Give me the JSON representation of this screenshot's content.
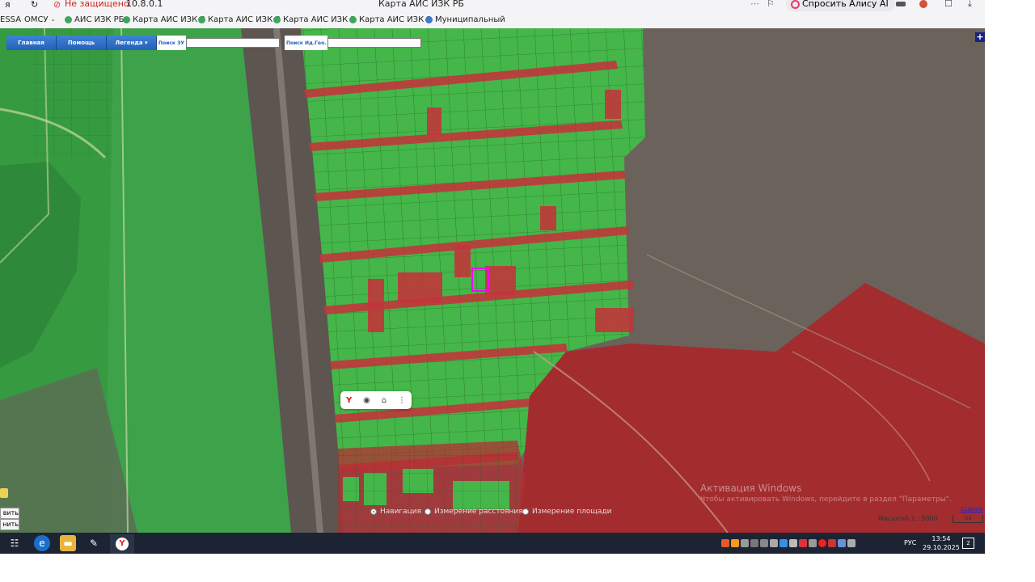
{
  "browser": {
    "logo": "я",
    "security_text": "Не защищено",
    "address": "10.8.0.1",
    "tab_title": "Карта АИС ИЗК РБ",
    "alice_label": "Спросить Алису AI"
  },
  "bookmarks": [
    {
      "label": "ESSA"
    },
    {
      "label": "ОМСУ"
    },
    {
      "label": "АИС ИЗК РБ"
    },
    {
      "label": "Карта АИС ИЗК Р"
    },
    {
      "label": "Карта АИС ИЗК Р"
    },
    {
      "label": "Карта АИС ИЗК Р"
    },
    {
      "label": "Карта АИС ИЗК Р"
    },
    {
      "label": "Муниципальный"
    }
  ],
  "map_toolbar": {
    "home": "Главная",
    "help": "Помощь",
    "legend": "Легенда",
    "search_zu_label": "Поиск ЗУ",
    "search_zu_value": "",
    "search_geo_label": "Поиск Ид.Гео.",
    "search_geo_value": ""
  },
  "left_controls": {
    "top": "вить",
    "bottom": "нить"
  },
  "measure": {
    "options": [
      "Навигация",
      "Измерение расстояния",
      "Измерение площади"
    ]
  },
  "watermark": {
    "title": "Активация Windows",
    "subtitle": "Чтобы активировать Windows, перейдите в раздел \"Параметры\"."
  },
  "scale": {
    "label": "Масштаб 1 : 5000",
    "bar": "Sa",
    "link": "Ссылка"
  },
  "taskbar": {
    "lang": "РУС",
    "time": "13:54",
    "date": "29.10.2025",
    "notif": "2"
  },
  "colors": {
    "zone_red": "#c0262b",
    "zone_green": "#35b043",
    "selected_parcel": "#ff00ff",
    "toolbar_blue": "#2461b8"
  }
}
